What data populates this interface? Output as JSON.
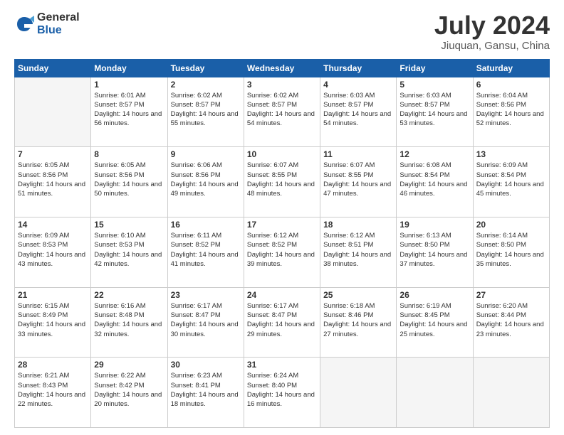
{
  "logo": {
    "general": "General",
    "blue": "Blue"
  },
  "title": "July 2024",
  "subtitle": "Jiuquan, Gansu, China",
  "days_header": [
    "Sunday",
    "Monday",
    "Tuesday",
    "Wednesday",
    "Thursday",
    "Friday",
    "Saturday"
  ],
  "weeks": [
    [
      {
        "day": "",
        "sunrise": "",
        "sunset": "",
        "daylight": ""
      },
      {
        "day": "1",
        "sunrise": "Sunrise: 6:01 AM",
        "sunset": "Sunset: 8:57 PM",
        "daylight": "Daylight: 14 hours and 56 minutes."
      },
      {
        "day": "2",
        "sunrise": "Sunrise: 6:02 AM",
        "sunset": "Sunset: 8:57 PM",
        "daylight": "Daylight: 14 hours and 55 minutes."
      },
      {
        "day": "3",
        "sunrise": "Sunrise: 6:02 AM",
        "sunset": "Sunset: 8:57 PM",
        "daylight": "Daylight: 14 hours and 54 minutes."
      },
      {
        "day": "4",
        "sunrise": "Sunrise: 6:03 AM",
        "sunset": "Sunset: 8:57 PM",
        "daylight": "Daylight: 14 hours and 54 minutes."
      },
      {
        "day": "5",
        "sunrise": "Sunrise: 6:03 AM",
        "sunset": "Sunset: 8:57 PM",
        "daylight": "Daylight: 14 hours and 53 minutes."
      },
      {
        "day": "6",
        "sunrise": "Sunrise: 6:04 AM",
        "sunset": "Sunset: 8:56 PM",
        "daylight": "Daylight: 14 hours and 52 minutes."
      }
    ],
    [
      {
        "day": "7",
        "sunrise": "Sunrise: 6:05 AM",
        "sunset": "Sunset: 8:56 PM",
        "daylight": "Daylight: 14 hours and 51 minutes."
      },
      {
        "day": "8",
        "sunrise": "Sunrise: 6:05 AM",
        "sunset": "Sunset: 8:56 PM",
        "daylight": "Daylight: 14 hours and 50 minutes."
      },
      {
        "day": "9",
        "sunrise": "Sunrise: 6:06 AM",
        "sunset": "Sunset: 8:56 PM",
        "daylight": "Daylight: 14 hours and 49 minutes."
      },
      {
        "day": "10",
        "sunrise": "Sunrise: 6:07 AM",
        "sunset": "Sunset: 8:55 PM",
        "daylight": "Daylight: 14 hours and 48 minutes."
      },
      {
        "day": "11",
        "sunrise": "Sunrise: 6:07 AM",
        "sunset": "Sunset: 8:55 PM",
        "daylight": "Daylight: 14 hours and 47 minutes."
      },
      {
        "day": "12",
        "sunrise": "Sunrise: 6:08 AM",
        "sunset": "Sunset: 8:54 PM",
        "daylight": "Daylight: 14 hours and 46 minutes."
      },
      {
        "day": "13",
        "sunrise": "Sunrise: 6:09 AM",
        "sunset": "Sunset: 8:54 PM",
        "daylight": "Daylight: 14 hours and 45 minutes."
      }
    ],
    [
      {
        "day": "14",
        "sunrise": "Sunrise: 6:09 AM",
        "sunset": "Sunset: 8:53 PM",
        "daylight": "Daylight: 14 hours and 43 minutes."
      },
      {
        "day": "15",
        "sunrise": "Sunrise: 6:10 AM",
        "sunset": "Sunset: 8:53 PM",
        "daylight": "Daylight: 14 hours and 42 minutes."
      },
      {
        "day": "16",
        "sunrise": "Sunrise: 6:11 AM",
        "sunset": "Sunset: 8:52 PM",
        "daylight": "Daylight: 14 hours and 41 minutes."
      },
      {
        "day": "17",
        "sunrise": "Sunrise: 6:12 AM",
        "sunset": "Sunset: 8:52 PM",
        "daylight": "Daylight: 14 hours and 39 minutes."
      },
      {
        "day": "18",
        "sunrise": "Sunrise: 6:12 AM",
        "sunset": "Sunset: 8:51 PM",
        "daylight": "Daylight: 14 hours and 38 minutes."
      },
      {
        "day": "19",
        "sunrise": "Sunrise: 6:13 AM",
        "sunset": "Sunset: 8:50 PM",
        "daylight": "Daylight: 14 hours and 37 minutes."
      },
      {
        "day": "20",
        "sunrise": "Sunrise: 6:14 AM",
        "sunset": "Sunset: 8:50 PM",
        "daylight": "Daylight: 14 hours and 35 minutes."
      }
    ],
    [
      {
        "day": "21",
        "sunrise": "Sunrise: 6:15 AM",
        "sunset": "Sunset: 8:49 PM",
        "daylight": "Daylight: 14 hours and 33 minutes."
      },
      {
        "day": "22",
        "sunrise": "Sunrise: 6:16 AM",
        "sunset": "Sunset: 8:48 PM",
        "daylight": "Daylight: 14 hours and 32 minutes."
      },
      {
        "day": "23",
        "sunrise": "Sunrise: 6:17 AM",
        "sunset": "Sunset: 8:47 PM",
        "daylight": "Daylight: 14 hours and 30 minutes."
      },
      {
        "day": "24",
        "sunrise": "Sunrise: 6:17 AM",
        "sunset": "Sunset: 8:47 PM",
        "daylight": "Daylight: 14 hours and 29 minutes."
      },
      {
        "day": "25",
        "sunrise": "Sunrise: 6:18 AM",
        "sunset": "Sunset: 8:46 PM",
        "daylight": "Daylight: 14 hours and 27 minutes."
      },
      {
        "day": "26",
        "sunrise": "Sunrise: 6:19 AM",
        "sunset": "Sunset: 8:45 PM",
        "daylight": "Daylight: 14 hours and 25 minutes."
      },
      {
        "day": "27",
        "sunrise": "Sunrise: 6:20 AM",
        "sunset": "Sunset: 8:44 PM",
        "daylight": "Daylight: 14 hours and 23 minutes."
      }
    ],
    [
      {
        "day": "28",
        "sunrise": "Sunrise: 6:21 AM",
        "sunset": "Sunset: 8:43 PM",
        "daylight": "Daylight: 14 hours and 22 minutes."
      },
      {
        "day": "29",
        "sunrise": "Sunrise: 6:22 AM",
        "sunset": "Sunset: 8:42 PM",
        "daylight": "Daylight: 14 hours and 20 minutes."
      },
      {
        "day": "30",
        "sunrise": "Sunrise: 6:23 AM",
        "sunset": "Sunset: 8:41 PM",
        "daylight": "Daylight: 14 hours and 18 minutes."
      },
      {
        "day": "31",
        "sunrise": "Sunrise: 6:24 AM",
        "sunset": "Sunset: 8:40 PM",
        "daylight": "Daylight: 14 hours and 16 minutes."
      },
      {
        "day": "",
        "sunrise": "",
        "sunset": "",
        "daylight": ""
      },
      {
        "day": "",
        "sunrise": "",
        "sunset": "",
        "daylight": ""
      },
      {
        "day": "",
        "sunrise": "",
        "sunset": "",
        "daylight": ""
      }
    ]
  ]
}
